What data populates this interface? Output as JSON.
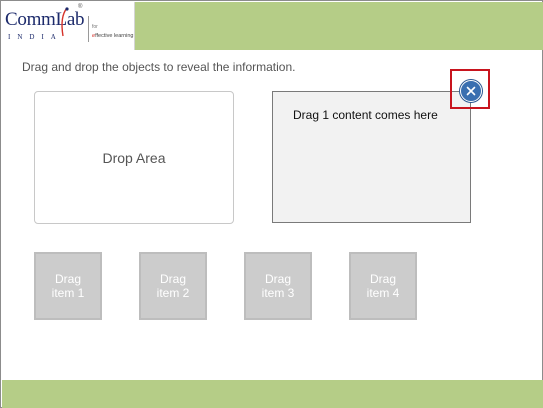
{
  "logo": {
    "main": "CommLab",
    "sub": "INDIA",
    "reg": "®",
    "for_text": "for",
    "tagline_prefix": "e",
    "tagline_rest": "ffective learning"
  },
  "instruction": "Drag and drop the objects to reveal the information.",
  "drop_area": {
    "label": "Drop Area"
  },
  "content_panel": {
    "text": "Drag 1 content comes here"
  },
  "drag_items": [
    {
      "line1": "Drag",
      "line2": "item 1"
    },
    {
      "line1": "Drag",
      "line2": "item 2"
    },
    {
      "line1": "Drag",
      "line2": "item 3"
    },
    {
      "line1": "Drag",
      "line2": "item 4"
    }
  ],
  "colors": {
    "header_bar": "#b5cd87",
    "close_button": "#3a6fb0",
    "highlight": "#c8141e",
    "drag_item": "#cccccc"
  },
  "icons": {
    "close": "close-icon"
  }
}
